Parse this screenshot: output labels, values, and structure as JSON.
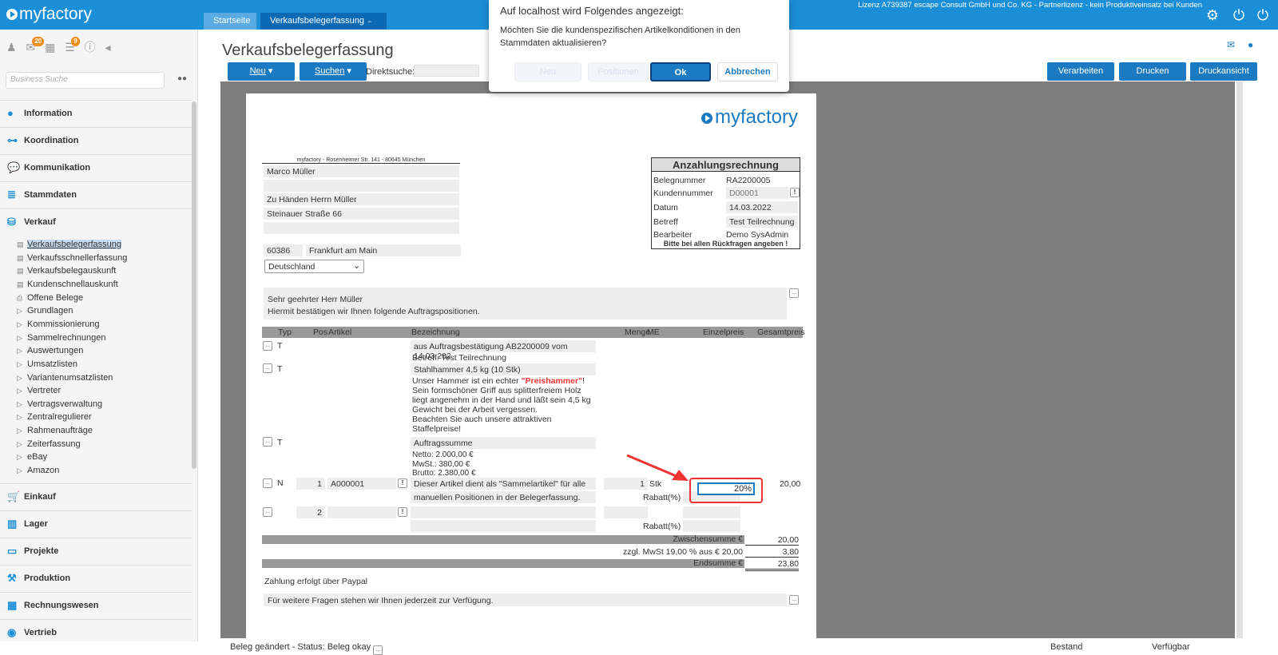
{
  "topbar": {
    "logo": "myfactory",
    "tabs": [
      {
        "label": "Startseite"
      },
      {
        "label": "Verkaufsbelegerfassung"
      }
    ],
    "tab_controls": "⇔ ▲ ×",
    "license": "Lizenz A739387 escape Consult GmbH und Co. KG - Partnerlizenz - kein Produktiveinsatz bei Kunden",
    "icons": [
      "gear-icon",
      "power-icon",
      "power-user-icon"
    ]
  },
  "sidebar": {
    "badges": {
      "messages": "20",
      "tasks": "9"
    },
    "search_placeholder": "Business Suche",
    "sections_top": [
      "Information",
      "Koordination",
      "Kommunikation",
      "Stammdaten",
      "Verkauf"
    ],
    "verkauf_items": [
      {
        "label": "Verkaufsbelegerfassung",
        "marker": "▤",
        "active": true
      },
      {
        "label": "Verkaufsschnellerfassung",
        "marker": "▤"
      },
      {
        "label": "Verkaufsbelegauskunft",
        "marker": "▤"
      },
      {
        "label": "Kundenschnellauskunft",
        "marker": "▤"
      },
      {
        "label": "Offene Belege",
        "marker": "⎙"
      },
      {
        "label": "Grundlagen",
        "marker": "▷"
      },
      {
        "label": "Kommissionierung",
        "marker": "▷"
      },
      {
        "label": "Sammelrechnungen",
        "marker": "▷"
      },
      {
        "label": "Auswertungen",
        "marker": "▷"
      },
      {
        "label": "Umsatzlisten",
        "marker": "▷"
      },
      {
        "label": "Variantenumsatzlisten",
        "marker": "▷"
      },
      {
        "label": "Vertreter",
        "marker": "▷"
      },
      {
        "label": "Vertragsverwaltung",
        "marker": "▷"
      },
      {
        "label": "Zentralregulierer",
        "marker": "▷"
      },
      {
        "label": "Rahmenaufträge",
        "marker": "▷"
      },
      {
        "label": "Zeiterfassung",
        "marker": "▷"
      },
      {
        "label": "eBay",
        "marker": "▷"
      },
      {
        "label": "Amazon",
        "marker": "▷"
      }
    ],
    "sections_bottom": [
      "Einkauf",
      "Lager",
      "Projekte",
      "Produktion",
      "Rechnungswesen",
      "Vertrieb"
    ]
  },
  "main": {
    "title": "Verkaufsbelegerfassung",
    "buttons": {
      "neu": "Neu",
      "suchen": "Suchen",
      "verarbeiten": "Verarbeiten",
      "drucken": "Drucken",
      "druckansicht": "Druckansicht"
    },
    "direktsuche_label": "Direktsuche:"
  },
  "document": {
    "logo": "myfactory",
    "sender_line": "myfactory - Rosenheimer Str. 141 - 80645 München",
    "address": [
      "Marco Müller",
      "",
      "Zu Händen Herrn Müller",
      "Steinauer Straße 66",
      ""
    ],
    "zip": "60386",
    "city": "Frankfurt am Main",
    "country": "Deutschland",
    "box": {
      "title": "Anzahlungsrechnung",
      "belegnummer_label": "Belegnummer",
      "belegnummer": "RA2200005",
      "kundennummer_label": "Kundennummer",
      "kundennummer": "D00001",
      "datum_label": "Datum",
      "datum": "14.03.2022",
      "betreff_label": "Betreff",
      "betreff": "Test Teilrechnung",
      "bearbeiter_label": "Bearbeiter",
      "bearbeiter": "Demo SysAdmin",
      "footer": "Bitte bei allen Rückfragen angeben !"
    },
    "salutation": "Sehr geehrter Herr Müller",
    "intro": "Hiermit bestätigen wir Ihnen folgende Auftragspositionen.",
    "table_headers": {
      "typ": "Typ",
      "pos": "Pos",
      "artikel": "Artikel",
      "bezeichnung": "Bezeichnung",
      "menge": "Menge",
      "me": "ME",
      "einzelpreis": "Einzelpreis",
      "gesamtpreis": "Gesamtpreis"
    },
    "rows": {
      "t1_typ": "T",
      "t1_text": "aus Auftragsbestätigung AB2200009 vom 14.03.202",
      "t1_sub": "Betreff: Test Teilrechnung",
      "t2_typ": "T",
      "t2_text": "Stahlhammer 4,5 kg (10 Stk)",
      "t2_desc1": "Unser Hammer ist ein echter ",
      "t2_desc_red": "\"Preishammer\"",
      "t2_desc1b": "!",
      "t2_desc2": "Sein formschöner Griff aus splitterfreiem Holz",
      "t2_desc3": "liegt angenehm in der Hand und läßt sein 4,5 kg",
      "t2_desc4": "Gewicht bei der Arbeit vergessen.",
      "t2_desc5": "Beachten Sie auch unsere attraktiven",
      "t2_desc6": "Staffelpreise!",
      "t3_typ": "T",
      "t3_text": "Auftragssumme",
      "t3_netto": "Netto: 2.000,00 €",
      "t3_mwst": "MwSt.: 380,00 €",
      "t3_brutto": "Brutto: 2.380,00 €",
      "n_typ": "N",
      "n_pos": "1",
      "n_artikel": "A000001",
      "n_text": "Dieser Artikel dient als \"Sammelartikel\" für alle",
      "n_text2": "manuellen Positionen in der Belegerfassung.",
      "n_menge": "1",
      "n_me": "Stk",
      "n_rabatt_label": "Rabatt(%)",
      "n_rabatt": "20%",
      "n_gesamt": "20,00",
      "e_pos": "2",
      "e_rabatt_label": "Rabatt(%)"
    },
    "zwischensumme_label": "Zwischensumme €",
    "zwischensumme": "20,00",
    "mwst_label": "zzgl. MwSt 19,00 % aus € 20,00",
    "mwst": "3,80",
    "endsumme_label": "Endsumme €",
    "endsumme": "23,80",
    "payment": "Zahlung erfolgt über Paypal",
    "closing": "Für weitere Fragen stehen wir Ihnen jederzeit zur Verfügung."
  },
  "status": {
    "text": "Beleg geändert - Status: Beleg okay",
    "bestand": "Bestand",
    "verfuegbar": "Verfügbar"
  },
  "dialog": {
    "title": "Auf localhost wird Folgendes angezeigt:",
    "message": "Möchten Sie die kundenspezifischen Artikelkonditionen in den Stammdaten aktualisieren?",
    "ok": "Ok",
    "cancel": "Abbrechen",
    "ghost1": "Neu",
    "ghost2": "Positionen"
  }
}
